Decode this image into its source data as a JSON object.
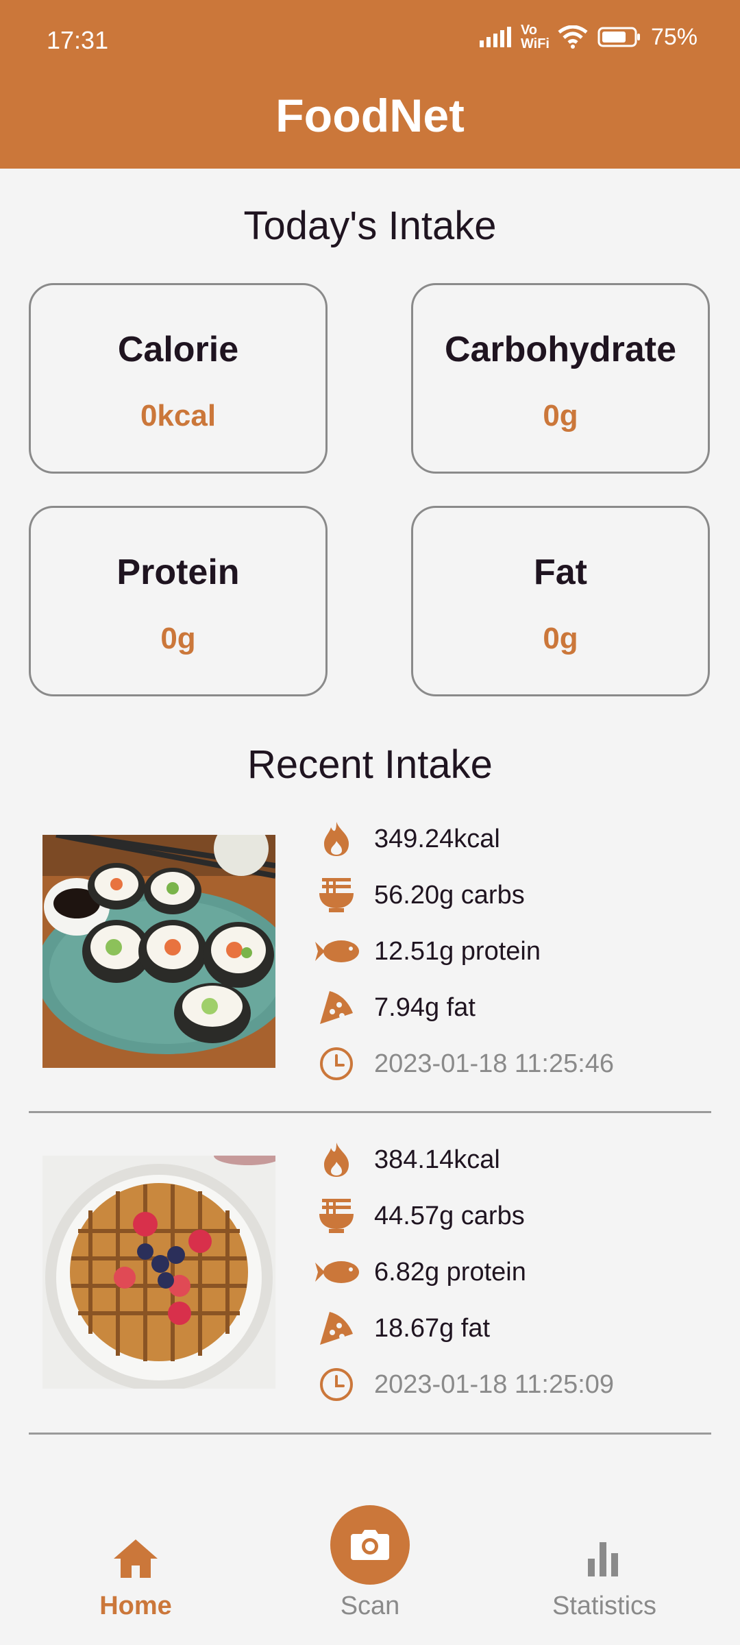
{
  "status": {
    "time": "17:31",
    "battery": "75%",
    "network": "Vo WiFi"
  },
  "app": {
    "title": "FoodNet"
  },
  "today": {
    "title": "Today's Intake",
    "cards": [
      {
        "label": "Calorie",
        "value": "0kcal"
      },
      {
        "label": "Carbohydrate",
        "value": "0g"
      },
      {
        "label": "Protein",
        "value": "0g"
      },
      {
        "label": "Fat",
        "value": "0g"
      }
    ]
  },
  "recent": {
    "title": "Recent Intake",
    "entries": [
      {
        "kcal": "349.24kcal",
        "carbs": "56.20g carbs",
        "protein": "12.51g protein",
        "fat": "7.94g fat",
        "time": "2023-01-18 11:25:46"
      },
      {
        "kcal": "384.14kcal",
        "carbs": "44.57g carbs",
        "protein": "6.82g protein",
        "fat": "18.67g fat",
        "time": "2023-01-18 11:25:09"
      }
    ]
  },
  "nav": {
    "home": "Home",
    "scan": "Scan",
    "statistics": "Statistics"
  },
  "colors": {
    "accent": "#cb773a",
    "background": "#f4f4f4",
    "text": "#1f1420",
    "muted": "#8a8a8a"
  }
}
